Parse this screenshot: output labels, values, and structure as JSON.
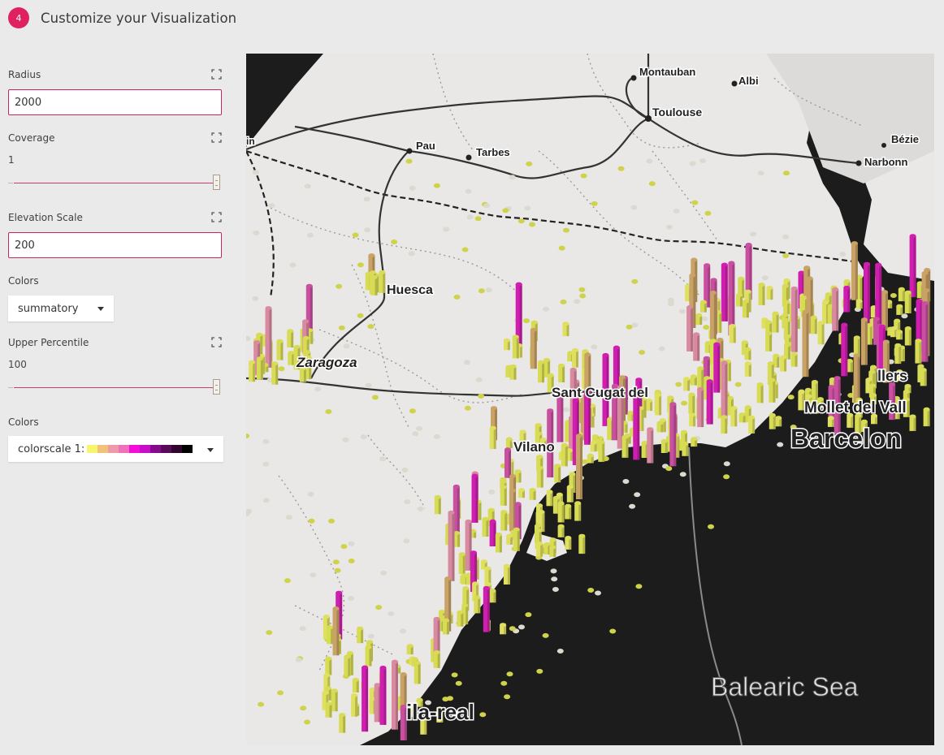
{
  "header": {
    "step": "4",
    "title": "Customize your Visualization"
  },
  "controls": {
    "radius": {
      "label": "Radius",
      "value": "2000"
    },
    "coverage": {
      "label": "Coverage",
      "value": "1",
      "fraction": 1.0
    },
    "elevation_scale": {
      "label": "Elevation Scale",
      "value": "200"
    },
    "colors": {
      "label": "Colors",
      "selected": "summatory"
    },
    "upper_percentile": {
      "label": "Upper Percentile",
      "value": "100",
      "fraction": 1.0
    },
    "colorscale": {
      "label": "Colors",
      "selected": "colorscale 1:",
      "swatches": [
        "#f5f56e",
        "#f0c27a",
        "#ef9aa8",
        "#ee71b9",
        "#f20fd7",
        "#c80cc8",
        "#840c8a",
        "#5a0a5a",
        "#2e062e",
        "#000000"
      ]
    },
    "icons": {
      "expand": "expand-icon",
      "dropdown": "caret-down-icon"
    }
  },
  "map": {
    "labels": {
      "montauban": "Montauban",
      "albi": "Albi",
      "toulouse": "Toulouse",
      "beziers": "Bézie",
      "pau": "Pau",
      "tarbes": "Tarbes",
      "narbonne": "Narbonn",
      "huesca": "Huesca",
      "zaragoza": "Zaragoza",
      "sant_cugat": "Sant Cugat del",
      "vilanova": "Vilano",
      "mollet": "Mollet del Vall",
      "barcelona": "Barcelon",
      "sabadell": "llers",
      "balearic": "Balearic Sea",
      "vila_real": "ila-real",
      "edge": "in"
    },
    "colors": {
      "land": "#e9e8e6",
      "sea": "#1c1c1c"
    }
  }
}
